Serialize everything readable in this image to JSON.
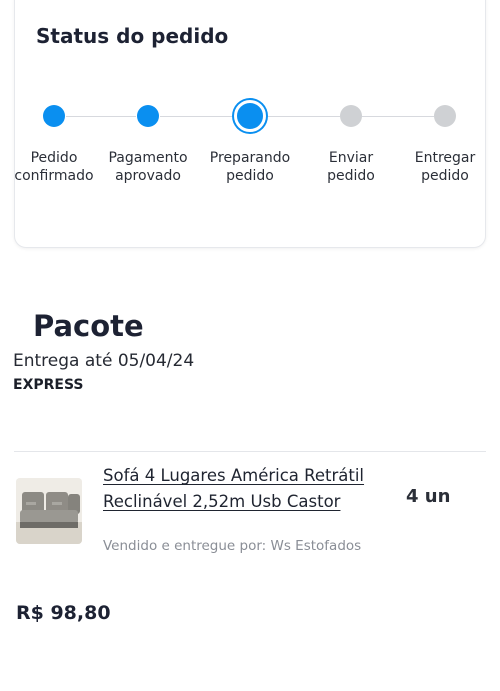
{
  "status": {
    "title": "Status do pedido",
    "steps": [
      {
        "line1": "Pedido",
        "line2": "confirmado",
        "state": "done"
      },
      {
        "line1": "Pagamento",
        "line2": "aprovado",
        "state": "done"
      },
      {
        "line1": "Preparando",
        "line2": "pedido",
        "state": "current"
      },
      {
        "line1": "Enviar",
        "line2": "pedido",
        "state": "pending"
      },
      {
        "line1": "Entregar",
        "line2": "pedido",
        "state": "pending"
      }
    ],
    "colors": {
      "done": "#0a8ff0",
      "pending": "#cfd1d4"
    }
  },
  "package": {
    "title": "Pacote",
    "delivery": "Entrega até 05/04/24",
    "type": "EXPRESS"
  },
  "product": {
    "image_icon": "sofa-image",
    "name": "Sofá 4 Lugares América Retrátil Reclinável 2,52m Usb Castor",
    "quantity": "4 un",
    "seller": "Vendido e entregue por: Ws Estofados",
    "price": "R$ 98,80"
  }
}
